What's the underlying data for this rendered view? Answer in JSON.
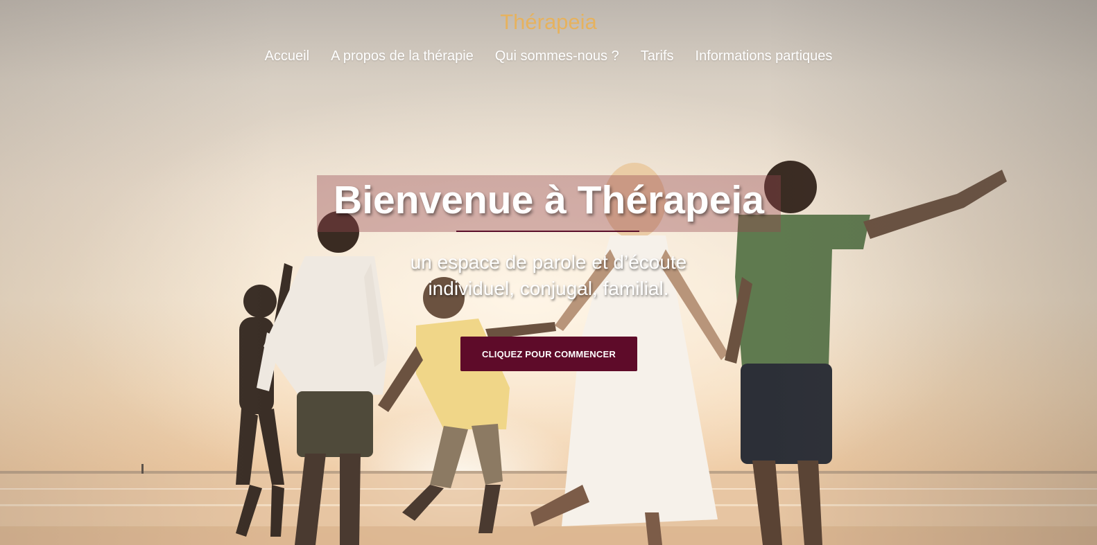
{
  "site": {
    "title": "Thérapeia"
  },
  "nav": {
    "items": [
      {
        "label": "Accueil"
      },
      {
        "label": "A propos de la thérapie"
      },
      {
        "label": "Qui sommes-nous ?"
      },
      {
        "label": "Tarifs"
      },
      {
        "label": "Informations partiques"
      }
    ]
  },
  "hero": {
    "headline": "Bienvenue à Thérapeia",
    "subtitle_line1": "un espace de parole et d’écoute",
    "subtitle_line2": "individuel, conjugal, familial.",
    "cta_label": "CLIQUEZ POUR COMMENCER",
    "image_icon": "family-beach-sunset-photo"
  },
  "colors": {
    "title": "#e6b25e",
    "accent": "#5e0b29",
    "headline_box": "rgba(150,70,80,0.38)",
    "text": "#ffffff"
  }
}
